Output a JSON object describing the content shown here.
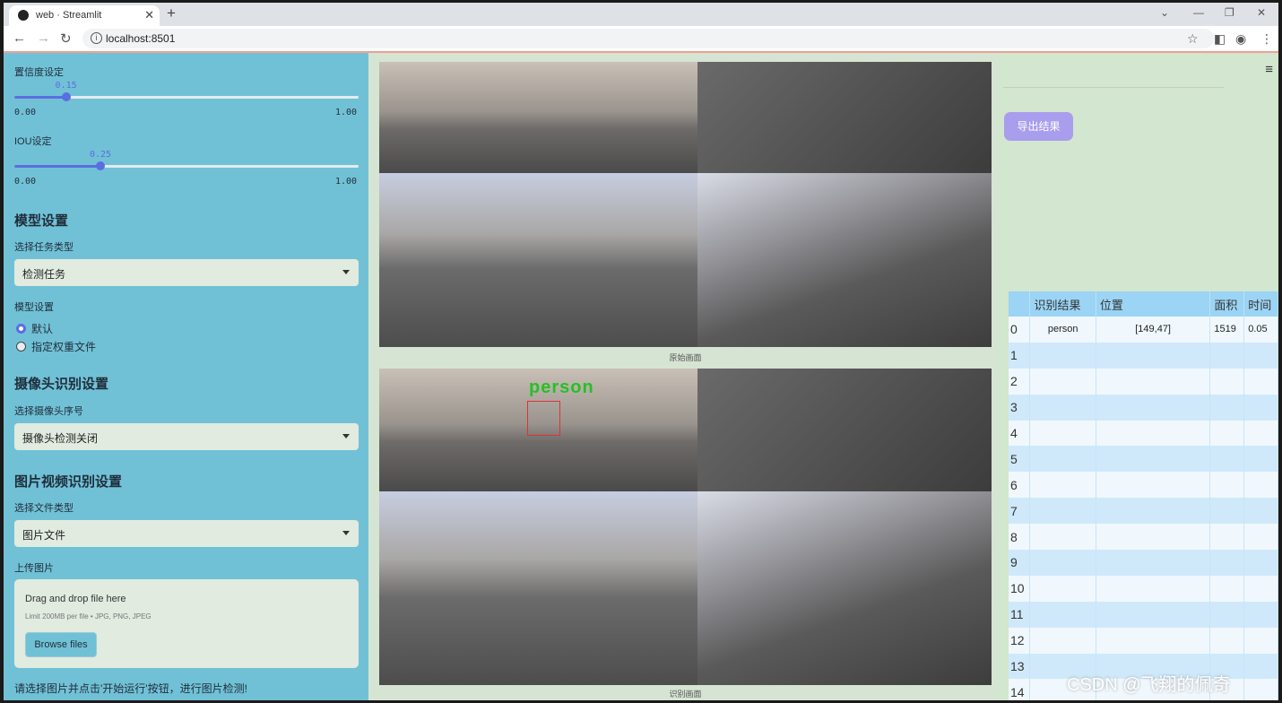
{
  "browser": {
    "tab_title": "web · Streamlit",
    "url": "localhost:8501"
  },
  "sidebar": {
    "confidence": {
      "label": "置信度设定",
      "value": "0.15",
      "level": 0.15,
      "min": "0.00",
      "max": "1.00"
    },
    "iou": {
      "label": "IOU设定",
      "value": "0.25",
      "level": 0.25,
      "min": "0.00",
      "max": "1.00"
    },
    "model_section": {
      "heading": "模型设置",
      "task_label": "选择任务类型",
      "task_value": "检测任务",
      "model_label": "模型设置",
      "options": [
        {
          "label": "默认",
          "selected": true
        },
        {
          "label": "指定权重文件",
          "selected": false
        }
      ]
    },
    "camera_section": {
      "heading": "摄像头识别设置",
      "label": "选择摄像头序号",
      "value": "摄像头检测关闭"
    },
    "media_section": {
      "heading": "图片视频识别设置",
      "file_type_label": "选择文件类型",
      "file_type_value": "图片文件",
      "upload_label": "上传图片",
      "drop_text": "Drag and drop file here",
      "limit_text": "Limit 200MB per file • JPG, PNG, JPEG",
      "browse_label": "Browse files"
    },
    "prompt": "请选择图片并点击'开始运行'按钮，进行图片检测!"
  },
  "main": {
    "original_caption": "原始画面",
    "result_caption": "识别画面",
    "detection_label": "person"
  },
  "right": {
    "export_label": "导出结果",
    "table": {
      "columns": [
        "识别结果",
        "位置",
        "面积",
        "时间"
      ],
      "rows": [
        {
          "index": "0",
          "result": "person",
          "position": "[149,47]",
          "area": "1519",
          "time": "0.05"
        },
        {
          "index": "1",
          "result": "",
          "position": "",
          "area": "",
          "time": ""
        },
        {
          "index": "2",
          "result": "",
          "position": "",
          "area": "",
          "time": ""
        },
        {
          "index": "3",
          "result": "",
          "position": "",
          "area": "",
          "time": ""
        },
        {
          "index": "4",
          "result": "",
          "position": "",
          "area": "",
          "time": ""
        },
        {
          "index": "5",
          "result": "",
          "position": "",
          "area": "",
          "time": ""
        },
        {
          "index": "6",
          "result": "",
          "position": "",
          "area": "",
          "time": ""
        },
        {
          "index": "7",
          "result": "",
          "position": "",
          "area": "",
          "time": ""
        },
        {
          "index": "8",
          "result": "",
          "position": "",
          "area": "",
          "time": ""
        },
        {
          "index": "9",
          "result": "",
          "position": "",
          "area": "",
          "time": ""
        },
        {
          "index": "10",
          "result": "",
          "position": "",
          "area": "",
          "time": ""
        },
        {
          "index": "11",
          "result": "",
          "position": "",
          "area": "",
          "time": ""
        },
        {
          "index": "12",
          "result": "",
          "position": "",
          "area": "",
          "time": ""
        },
        {
          "index": "13",
          "result": "",
          "position": "",
          "area": "",
          "time": ""
        },
        {
          "index": "14",
          "result": "",
          "position": "",
          "area": "",
          "time": ""
        }
      ]
    }
  },
  "watermark": "CSDN @飞翔的佩奇",
  "colors": {
    "sidebar_bg": "#71c1d6",
    "accent": "#5b6ee1",
    "export_button": "#a99ded",
    "table_header": "#9bd4f4"
  }
}
